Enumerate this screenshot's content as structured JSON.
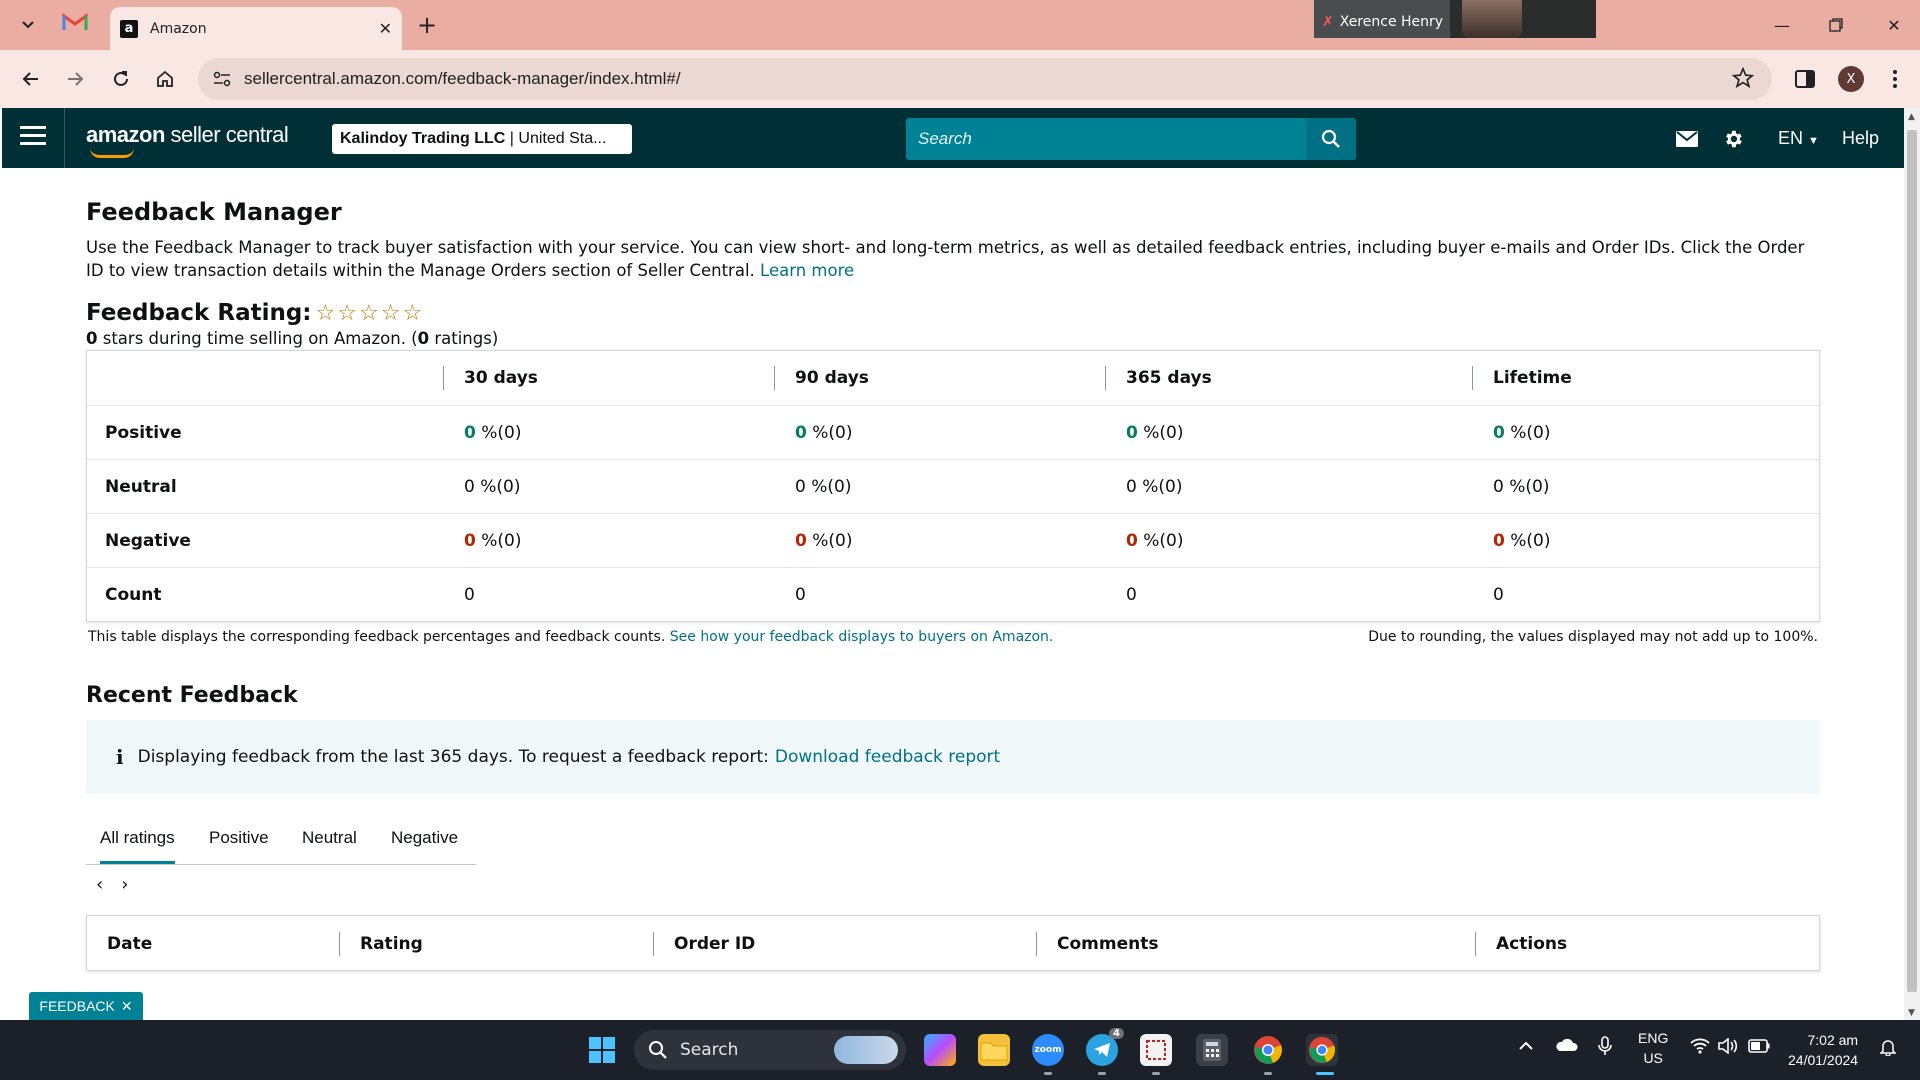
{
  "browser": {
    "active_tab_title": "Amazon",
    "url": "sellercentral.amazon.com/feedback-manager/index.html#/",
    "video_call_name": "Xerence Henry",
    "profile_initial": "X"
  },
  "header": {
    "logo_main": "amazon",
    "logo_sub": "seller central",
    "account_name": "Kalindoy Trading LLC",
    "account_region": "United Sta...",
    "search_placeholder": "Search",
    "language": "EN",
    "help": "Help"
  },
  "page": {
    "title": "Feedback Manager",
    "intro": "Use the Feedback Manager to track buyer satisfaction with your service. You can view short- and long-term metrics, as well as detailed feedback entries, including buyer e-mails and Order IDs. Click the Order ID to view transaction details within the Manage Orders section of Seller Central.",
    "learn_more": "Learn more",
    "rating_title": "Feedback Rating:",
    "rating_stars_filled": 0,
    "rating_stars_total": 5,
    "rating_summary_stars": "0",
    "rating_summary_mid": "stars during time selling on Amazon. (",
    "rating_summary_count": "0",
    "rating_summary_end": "ratings)"
  },
  "feedback_table": {
    "columns": [
      "30 days",
      "90 days",
      "365 days",
      "Lifetime"
    ],
    "rows": [
      {
        "label": "Positive",
        "cells": [
          {
            "num": "0",
            "rest": " %(0)"
          },
          {
            "num": "0",
            "rest": " %(0)"
          },
          {
            "num": "0",
            "rest": " %(0)"
          },
          {
            "num": "0",
            "rest": " %(0)"
          }
        ]
      },
      {
        "label": "Neutral",
        "cells": [
          {
            "num": "0",
            "rest": " %(0)"
          },
          {
            "num": "0",
            "rest": " %(0)"
          },
          {
            "num": "0",
            "rest": " %(0)"
          },
          {
            "num": "0",
            "rest": " %(0)"
          }
        ]
      },
      {
        "label": "Negative",
        "cells": [
          {
            "num": "0",
            "rest": " %(0)"
          },
          {
            "num": "0",
            "rest": " %(0)"
          },
          {
            "num": "0",
            "rest": " %(0)"
          },
          {
            "num": "0",
            "rest": " %(0)"
          }
        ]
      },
      {
        "label": "Count",
        "cells": [
          {
            "num": "0",
            "rest": ""
          },
          {
            "num": "0",
            "rest": ""
          },
          {
            "num": "0",
            "rest": ""
          },
          {
            "num": "0",
            "rest": ""
          }
        ]
      }
    ],
    "note": "This table displays the corresponding feedback percentages and feedback counts.",
    "note_link": "See how your feedback displays to buyers on Amazon.",
    "rounding_note": "Due to rounding, the values displayed may not add up to 100%."
  },
  "recent": {
    "title": "Recent Feedback",
    "info_text": "Displaying feedback from the last 365 days. To request a feedback report:",
    "info_link": "Download feedback report",
    "tabs": [
      "All ratings",
      "Positive",
      "Neutral",
      "Negative"
    ],
    "active_tab": "All ratings",
    "columns": [
      "Date",
      "Rating",
      "Order ID",
      "Comments",
      "Actions"
    ]
  },
  "feedback_chip": "FEEDBACK",
  "taskbar": {
    "search": "Search",
    "telegram_badge": "4",
    "lang_top": "ENG",
    "lang_bottom": "US",
    "time": "7:02 am",
    "date": "24/01/2024"
  },
  "colors": {
    "header_bg": "#002f36",
    "search_bg": "#008296",
    "link": "#007185",
    "positive": "#067d62",
    "negative": "#b12704",
    "tab_strip": "#e9aea1"
  }
}
